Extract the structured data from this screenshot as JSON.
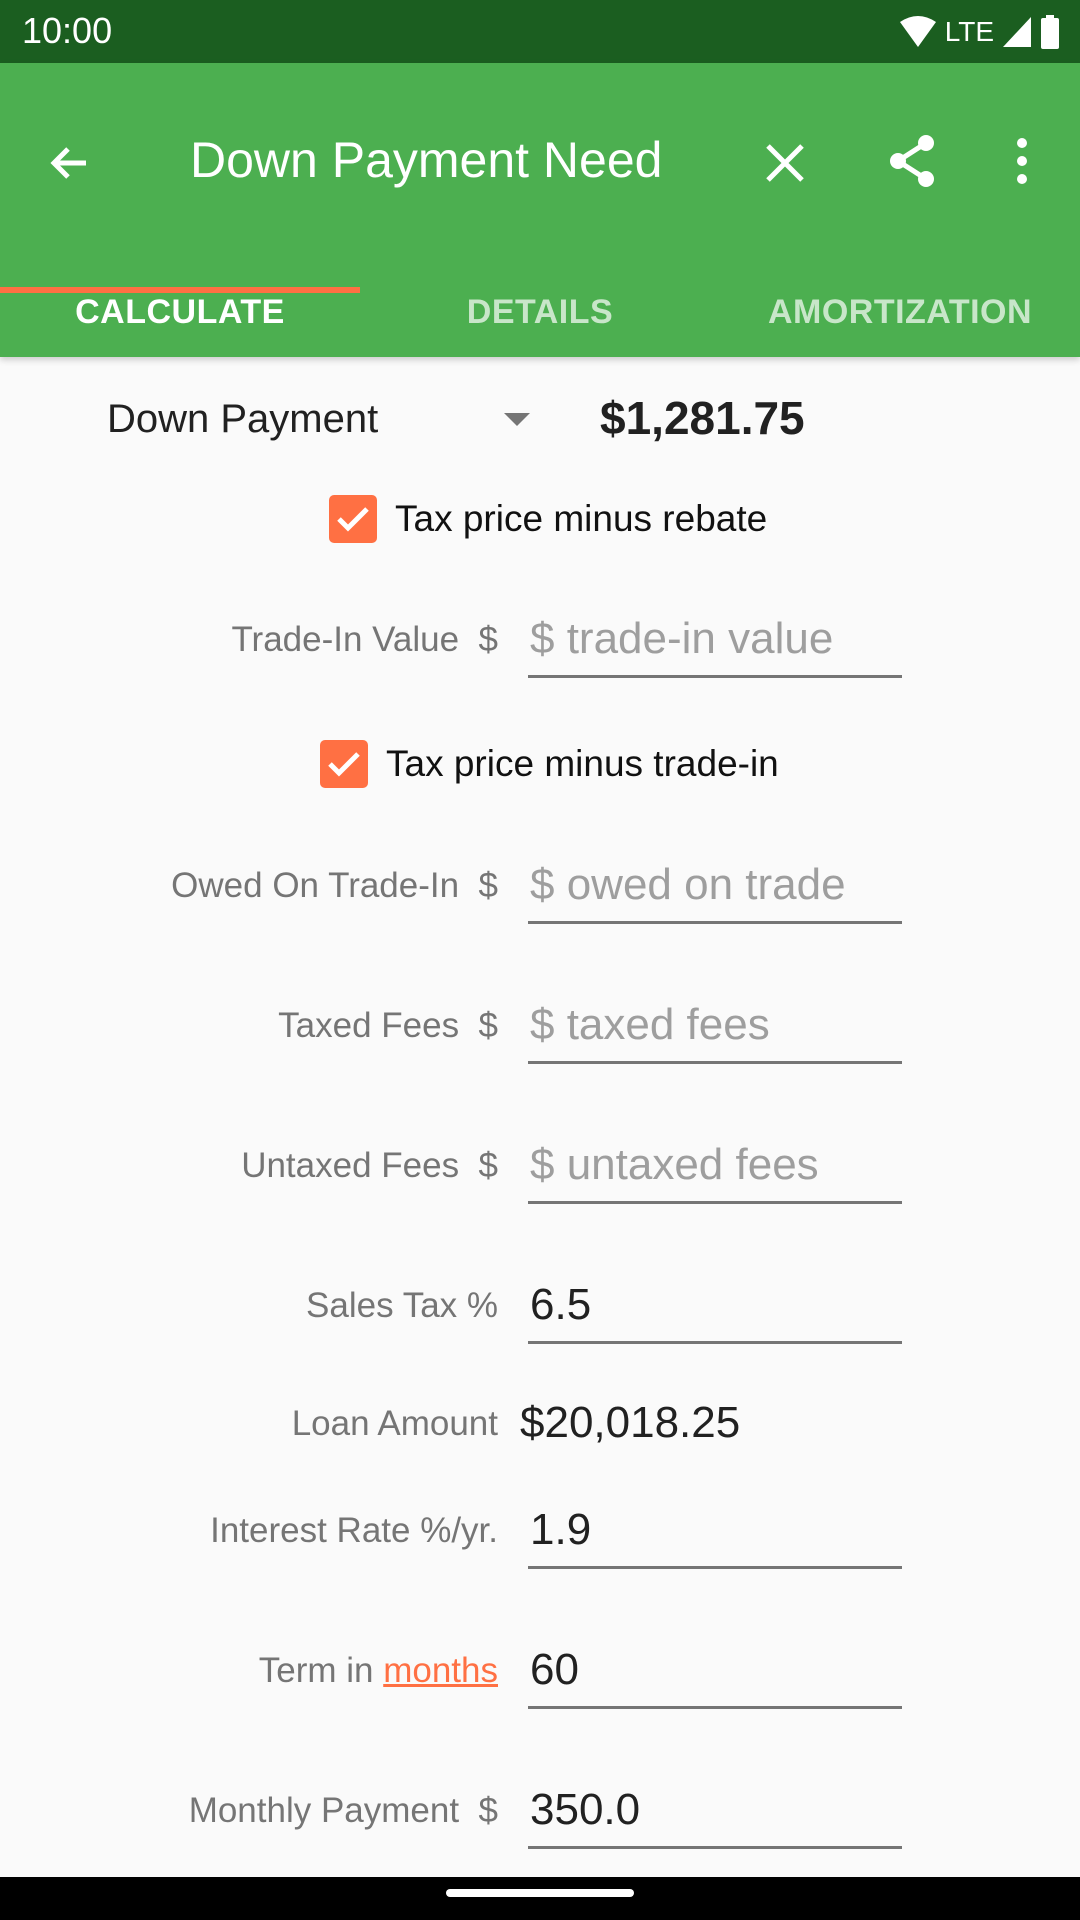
{
  "status_bar": {
    "time": "10:00",
    "network": "LTE"
  },
  "app_bar": {
    "title": "Down Payment Need",
    "icons": [
      "back-arrow-icon",
      "close-icon",
      "share-icon",
      "more-vert-icon"
    ]
  },
  "tabs": [
    {
      "label": "CALCULATE",
      "active": true
    },
    {
      "label": "DETAILS",
      "active": false
    },
    {
      "label": "AMORTIZATION",
      "active": false
    }
  ],
  "calculate": {
    "spinner_selected": "Down Payment",
    "result": "$1,281.75",
    "checkbox_rebate": {
      "label": "Tax price minus rebate",
      "checked": true
    },
    "checkbox_trade": {
      "label": "Tax price minus trade-in",
      "checked": true
    },
    "fields": {
      "trade_in": {
        "label": "Trade-In Value  $",
        "value": "",
        "placeholder": "$ trade-in value"
      },
      "owed": {
        "label": "Owed On Trade-In  $",
        "value": "",
        "placeholder": "$ owed on trade"
      },
      "taxed_fees": {
        "label": "Taxed Fees  $",
        "value": "",
        "placeholder": "$ taxed fees"
      },
      "untaxed_fees": {
        "label": "Untaxed Fees  $",
        "value": "",
        "placeholder": "$ untaxed fees"
      },
      "sales_tax": {
        "label": "Sales Tax %",
        "value": "6.5"
      },
      "loan_amount": {
        "label": "Loan Amount",
        "value": "$20,018.25"
      },
      "interest_rate": {
        "label": "Interest Rate %/yr.",
        "value": "1.9"
      },
      "term": {
        "label_prefix": "Term in ",
        "label_link": "months",
        "value": "60"
      },
      "monthly_payment": {
        "label": "Monthly Payment  $",
        "value": "350.0"
      }
    }
  },
  "colors": {
    "status_bar": "#1b5e20",
    "app_bar": "#4caf50",
    "accent": "#ff7043",
    "tab_inactive": "#c8e6c9"
  }
}
